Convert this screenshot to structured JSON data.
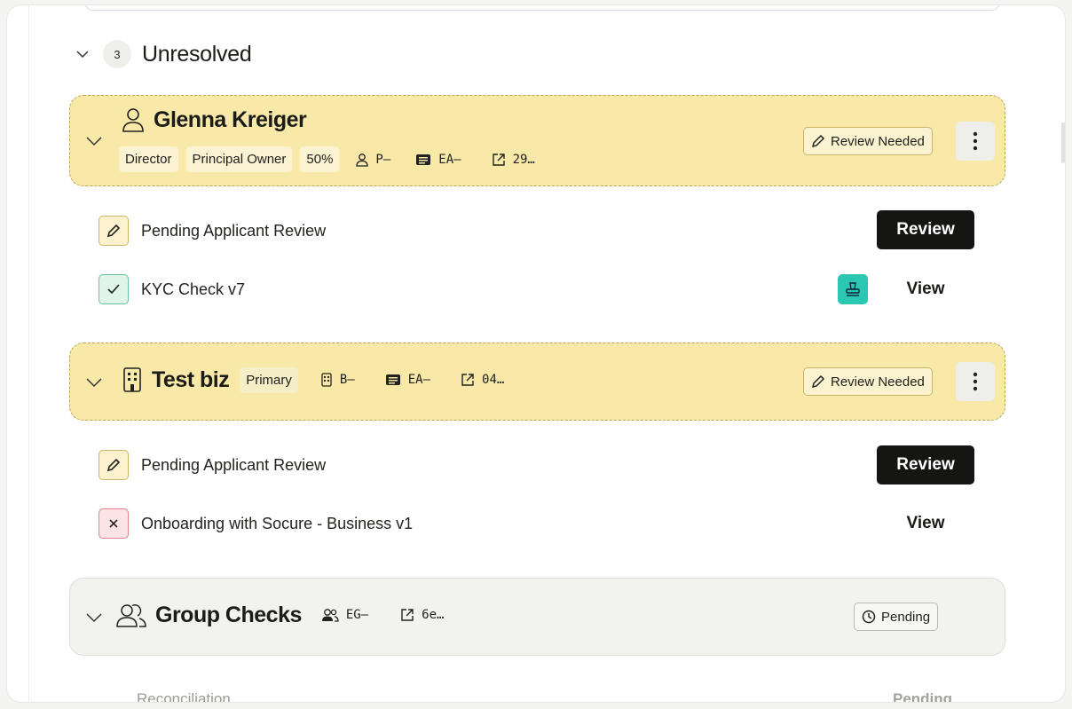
{
  "section": {
    "count": "3",
    "title": "Unresolved"
  },
  "cards": [
    {
      "title": "Glenna Kreiger",
      "tags": [
        "Director",
        "Principal Owner",
        "50%"
      ],
      "meta": [
        "P–",
        "EA–",
        "29…"
      ],
      "status": "Review Needed",
      "checks": [
        {
          "label": "Pending Applicant Review",
          "action": "Review"
        },
        {
          "label": "KYC Check v7",
          "action": "View"
        }
      ]
    },
    {
      "title": "Test biz",
      "tags": [
        "Primary"
      ],
      "meta": [
        "B–",
        "EA–",
        "04…"
      ],
      "status": "Review Needed",
      "checks": [
        {
          "label": "Pending Applicant Review",
          "action": "Review"
        },
        {
          "label": "Onboarding with Socure - Business v1",
          "action": "View"
        }
      ]
    },
    {
      "title": "Group Checks",
      "meta": [
        "EG–",
        "6e…"
      ],
      "status": "Pending",
      "checks": [
        {
          "label": "Reconciliation",
          "action": "Pending"
        }
      ]
    }
  ],
  "colors": {
    "card_yellow": "#f8e9a8",
    "card_grey": "#f2f2ee",
    "stamp_teal": "#2bc7b2",
    "button_dark": "#151513"
  }
}
